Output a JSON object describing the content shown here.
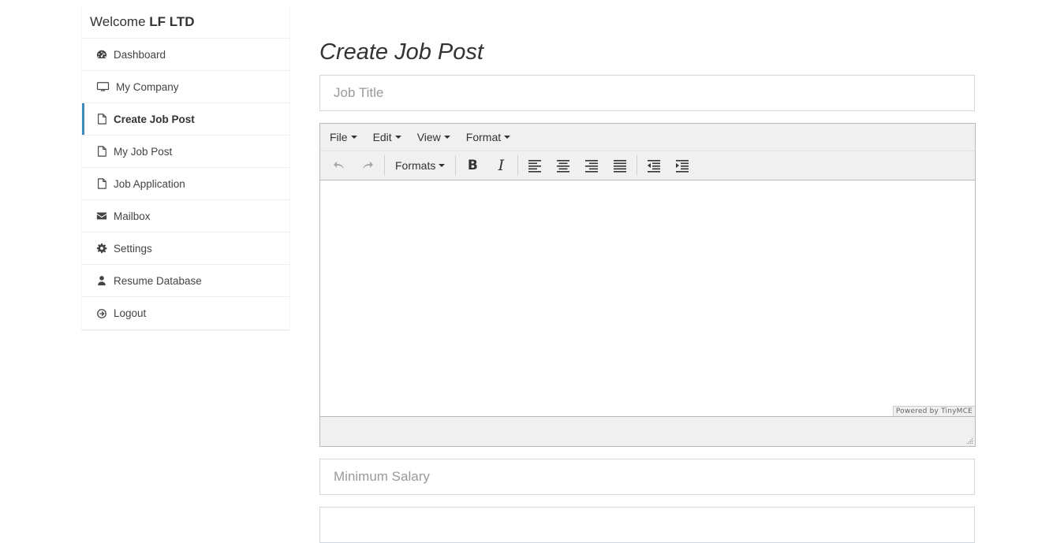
{
  "sidebar": {
    "welcome_prefix": "Welcome",
    "company_name": "LF LTD",
    "items": [
      {
        "label": "Dashboard",
        "icon": "dashboard-icon"
      },
      {
        "label": "My Company",
        "icon": "desktop-icon"
      },
      {
        "label": "Create Job Post",
        "icon": "file-icon",
        "active": true
      },
      {
        "label": "My Job Post",
        "icon": "file-icon"
      },
      {
        "label": "Job Application",
        "icon": "file-icon"
      },
      {
        "label": "Mailbox",
        "icon": "envelope-icon"
      },
      {
        "label": "Settings",
        "icon": "gear-icon"
      },
      {
        "label": "Resume Database",
        "icon": "user-icon"
      },
      {
        "label": "Logout",
        "icon": "logout-icon"
      }
    ],
    "accent_color": "#3c8dbc"
  },
  "main": {
    "title": "Create Job Post",
    "job_title_placeholder": "Job Title",
    "min_salary_placeholder": "Minimum Salary",
    "max_salary_placeholder": ""
  },
  "editor": {
    "menus": [
      "File",
      "Edit",
      "View",
      "Format"
    ],
    "formats_label": "Formats",
    "bold_label": "B",
    "italic_label": "I",
    "powered_by": "Powered by TinyMCE"
  }
}
